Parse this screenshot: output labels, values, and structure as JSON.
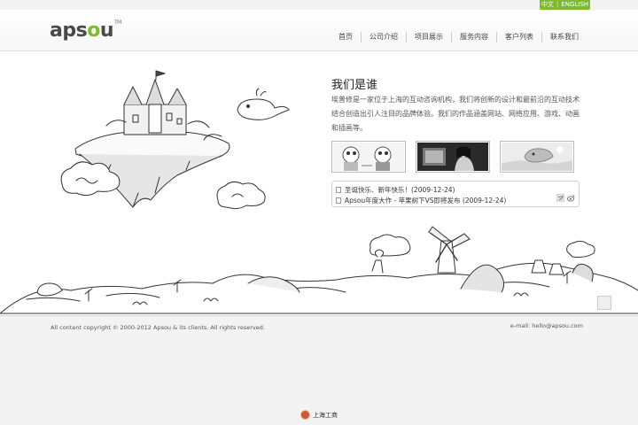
{
  "lang": {
    "zh": "中文",
    "separator": "|",
    "en": "ENGLISH"
  },
  "logo": {
    "text_a": "aps",
    "text_o": "o",
    "text_b": "u",
    "tm": "TM"
  },
  "nav": {
    "items": [
      {
        "label": "首页"
      },
      {
        "label": "公司介绍"
      },
      {
        "label": "项目展示"
      },
      {
        "label": "服务内容"
      },
      {
        "label": "客户列表"
      },
      {
        "label": "联系我们"
      }
    ]
  },
  "about": {
    "title": "我们是谁",
    "text": "埃普修是一家位于上海的互动咨询机构，我们将创新的设计和最前沿的互动技术结合创造出引人注目的品牌体验。我们的作品涵盖网站、网络应用、游戏、动画和插画等。"
  },
  "news": {
    "items": [
      {
        "text": "圣诞快乐、新年快乐！(2009-12-24)"
      },
      {
        "text": "Apsou年度大作 - 苹果树下VS即将发布 (2009-12-24)"
      }
    ]
  },
  "footer": {
    "copyright": "All content copyright © 2000-2012 Apsou & its clients. All rights reserved.",
    "email": "e-mail: hello@apsou.com"
  },
  "badge": {
    "label": "上海工商"
  }
}
